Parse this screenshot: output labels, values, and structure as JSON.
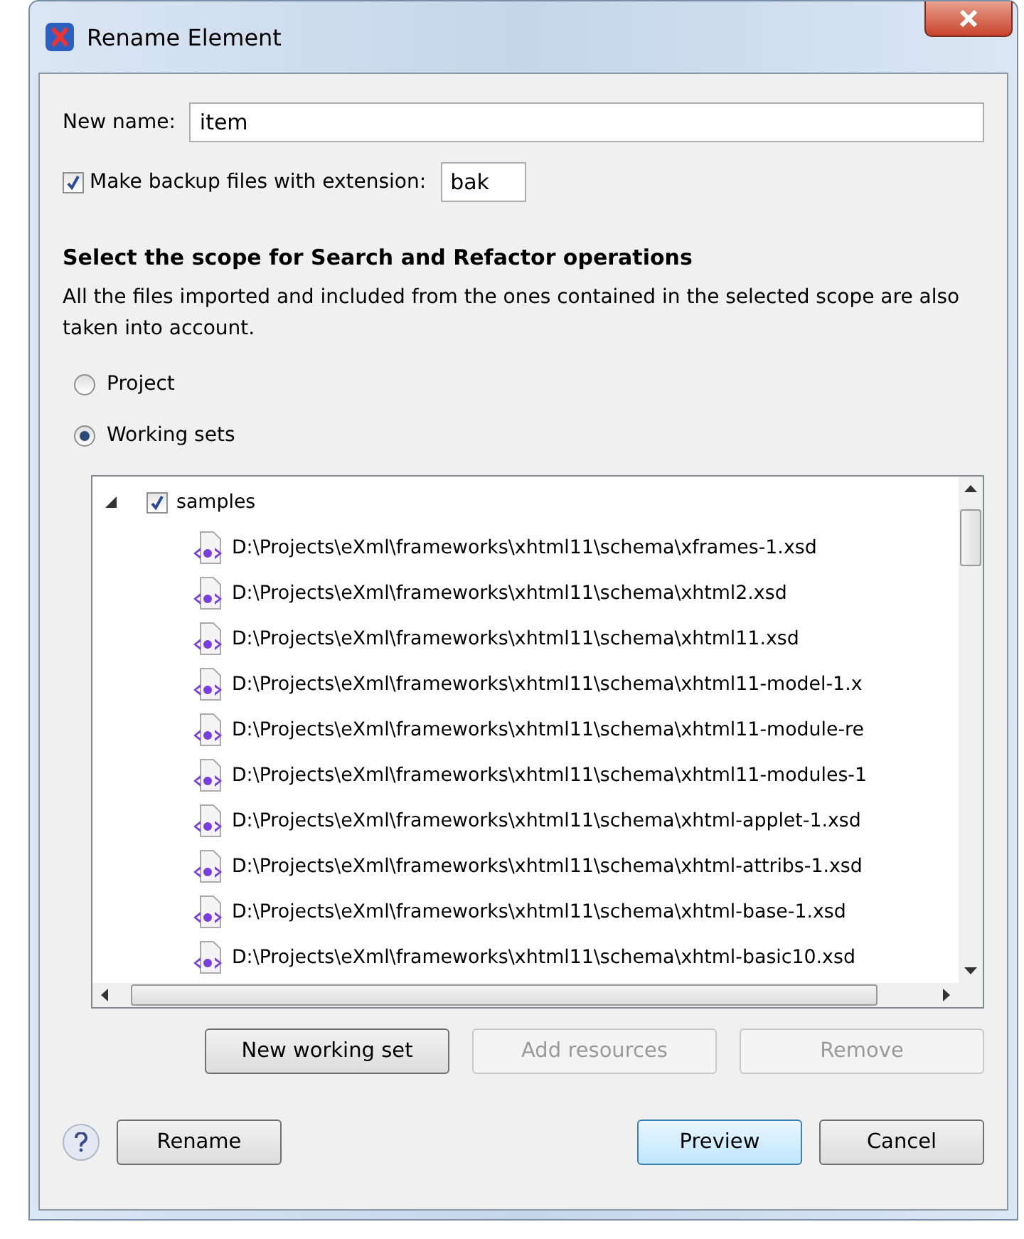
{
  "window": {
    "title": "Rename Element"
  },
  "new_name": {
    "label": "New name:",
    "value": "item"
  },
  "backup": {
    "label": "Make backup files with extension:",
    "checked": true,
    "value": "bak"
  },
  "scope": {
    "heading": "Select the scope for Search and Refactor operations",
    "description": "All the files imported and included from the ones contained in the selected scope are also taken into account.",
    "options": [
      {
        "label": "Project",
        "selected": false
      },
      {
        "label": "Working sets",
        "selected": true
      }
    ]
  },
  "tree": {
    "items": [
      {
        "label": "samples",
        "checked": true,
        "expanded": true,
        "children": [
          {
            "label": "D:\\Projects\\eXml\\frameworks\\xhtml11\\schema\\xframes-1.xsd"
          },
          {
            "label": "D:\\Projects\\eXml\\frameworks\\xhtml11\\schema\\xhtml2.xsd"
          },
          {
            "label": "D:\\Projects\\eXml\\frameworks\\xhtml11\\schema\\xhtml11.xsd"
          },
          {
            "label": "D:\\Projects\\eXml\\frameworks\\xhtml11\\schema\\xhtml11-model-1.x"
          },
          {
            "label": "D:\\Projects\\eXml\\frameworks\\xhtml11\\schema\\xhtml11-module-re"
          },
          {
            "label": "D:\\Projects\\eXml\\frameworks\\xhtml11\\schema\\xhtml11-modules-1"
          },
          {
            "label": "D:\\Projects\\eXml\\frameworks\\xhtml11\\schema\\xhtml-applet-1.xsd"
          },
          {
            "label": "D:\\Projects\\eXml\\frameworks\\xhtml11\\schema\\xhtml-attribs-1.xsd"
          },
          {
            "label": "D:\\Projects\\eXml\\frameworks\\xhtml11\\schema\\xhtml-base-1.xsd"
          },
          {
            "label": "D:\\Projects\\eXml\\frameworks\\xhtml11\\schema\\xhtml-basic10.xsd"
          }
        ]
      }
    ]
  },
  "working_set_buttons": [
    {
      "label": "New working set",
      "disabled": false
    },
    {
      "label": "Add resources",
      "disabled": true
    },
    {
      "label": "Remove",
      "disabled": true
    }
  ],
  "footer_buttons": [
    {
      "label": "Rename",
      "focused": false
    },
    {
      "label": "Preview",
      "focused": true
    },
    {
      "label": "Cancel",
      "focused": false
    }
  ]
}
